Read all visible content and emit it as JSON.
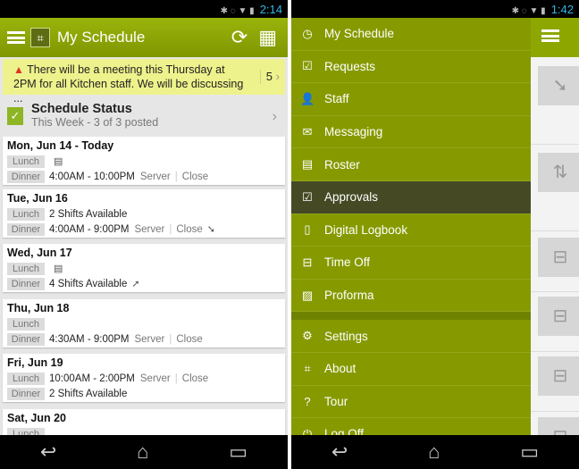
{
  "left": {
    "status_time": "2:14",
    "title": "My Schedule",
    "banner": {
      "text": "There will be a meeting this Thursday at 2PM for all Kitchen staff. We will be discussing ...",
      "count": "5"
    },
    "schedule_status": {
      "title": "Schedule Status",
      "subtitle": "This Week - 3 of 3 posted"
    },
    "days": [
      {
        "date": "Mon, Jun 14 - Today",
        "rows": [
          {
            "meal": "Lunch",
            "text": "",
            "icon": "calendar-icon"
          },
          {
            "meal": "Dinner",
            "text": "4:00AM - 10:00PM",
            "role": "Server",
            "loc": "Close"
          }
        ]
      },
      {
        "date": "Tue, Jun 16",
        "rows": [
          {
            "meal": "Lunch",
            "text": "2 Shifts Available"
          },
          {
            "meal": "Dinner",
            "text": "4:00AM - 9:00PM",
            "role": "Server",
            "loc": "Close",
            "icon": "giveaway-icon"
          }
        ]
      },
      {
        "date": "Wed, Jun 17",
        "rows": [
          {
            "meal": "Lunch",
            "text": "",
            "icon": "calendar-icon"
          },
          {
            "meal": "Dinner",
            "text": "4 Shifts Available",
            "icon": "pickup-icon"
          }
        ]
      },
      {
        "date": "Thu, Jun 18",
        "rows": [
          {
            "meal": "Lunch",
            "text": ""
          },
          {
            "meal": "Dinner",
            "text": "4:30AM - 9:00PM",
            "role": "Server",
            "loc": "Close"
          }
        ]
      },
      {
        "date": "Fri, Jun 19",
        "rows": [
          {
            "meal": "Lunch",
            "text": "10:00AM - 2:00PM",
            "role": "Server",
            "loc": "Close"
          },
          {
            "meal": "Dinner",
            "text": "2 Shifts Available"
          }
        ]
      },
      {
        "date": "Sat, Jun 20",
        "rows": [
          {
            "meal": "Lunch",
            "text": ""
          }
        ]
      }
    ]
  },
  "right": {
    "status_time": "1:42",
    "menu": [
      {
        "label": "My Schedule",
        "icon": "clock-icon"
      },
      {
        "label": "Requests",
        "icon": "calendar-check-icon"
      },
      {
        "label": "Staff",
        "icon": "person-icon"
      },
      {
        "label": "Messaging",
        "icon": "envelope-icon"
      },
      {
        "label": "Roster",
        "icon": "document-icon"
      },
      {
        "label": "Approvals",
        "icon": "checkbox-icon",
        "active": true
      },
      {
        "label": "Digital Logbook",
        "icon": "book-icon"
      },
      {
        "label": "Time Off",
        "icon": "calendar-minus-icon"
      },
      {
        "label": "Proforma",
        "icon": "chart-icon"
      }
    ],
    "menu2": [
      {
        "label": "Settings",
        "icon": "gear-icon"
      },
      {
        "label": "About",
        "icon": "logo-icon"
      },
      {
        "label": "Tour",
        "icon": "question-icon"
      },
      {
        "label": "Log Off",
        "icon": "power-icon"
      }
    ]
  },
  "colors": {
    "accent": "#869a00",
    "active": "#454a24",
    "banner": "#eef28c"
  }
}
